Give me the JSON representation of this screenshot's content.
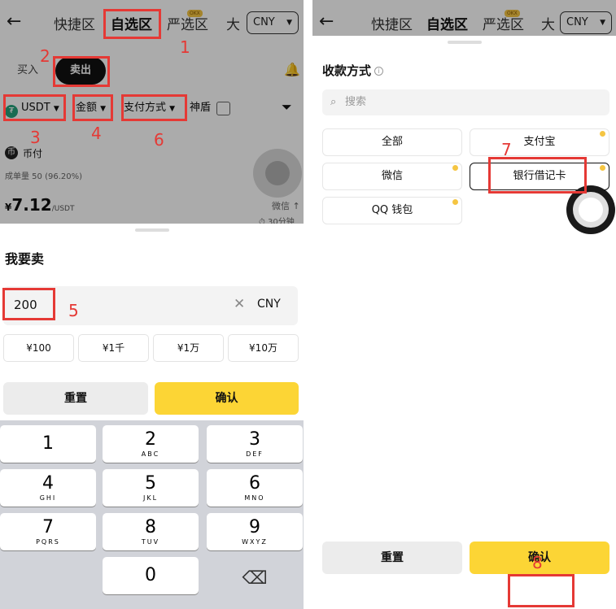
{
  "left": {
    "topbar": {
      "back_icon": "←",
      "tabs": [
        "快捷区",
        "自选区",
        "严选区",
        "大"
      ],
      "badge": "OKX",
      "currency": "CNY"
    },
    "segment": {
      "buy": "买入",
      "sell": "卖出"
    },
    "filters": {
      "coin": "USDT",
      "amount": "金额",
      "payment": "支付方式",
      "shield": "神盾"
    },
    "ad": {
      "merchant": "币付",
      "stats": "成单量 50 (96.20%)",
      "price_symbol": "¥",
      "price": "7.12",
      "price_unit": "/USDT",
      "pay": "微信 ↑",
      "time": "⏱ 30分钟"
    },
    "sheet": {
      "title": "我要卖",
      "amount_value": "200",
      "amount_currency": "CNY",
      "quick_amounts": [
        "¥100",
        "¥1千",
        "¥1万",
        "¥10万"
      ],
      "reset": "重置",
      "confirm": "确认"
    },
    "keypad": [
      {
        "num": "1",
        "sub": ""
      },
      {
        "num": "2",
        "sub": "ABC"
      },
      {
        "num": "3",
        "sub": "DEF"
      },
      {
        "num": "4",
        "sub": "GHI"
      },
      {
        "num": "5",
        "sub": "JKL"
      },
      {
        "num": "6",
        "sub": "MNO"
      },
      {
        "num": "7",
        "sub": "PQRS"
      },
      {
        "num": "8",
        "sub": "TUV"
      },
      {
        "num": "9",
        "sub": "WXYZ"
      },
      {
        "num": "0",
        "sub": ""
      }
    ]
  },
  "right": {
    "topbar": {
      "tabs": [
        "快捷区",
        "自选区",
        "严选区",
        "大"
      ],
      "currency": "CNY"
    },
    "sheet": {
      "title": "收款方式",
      "search_placeholder": "搜索",
      "options": [
        "全部",
        "支付宝",
        "微信",
        "银行借记卡",
        "QQ 钱包"
      ],
      "selected": "银行借记卡",
      "reset": "重置",
      "confirm": "确认"
    }
  },
  "annotations": [
    "1",
    "2",
    "3",
    "4",
    "5",
    "6",
    "7",
    "8"
  ]
}
